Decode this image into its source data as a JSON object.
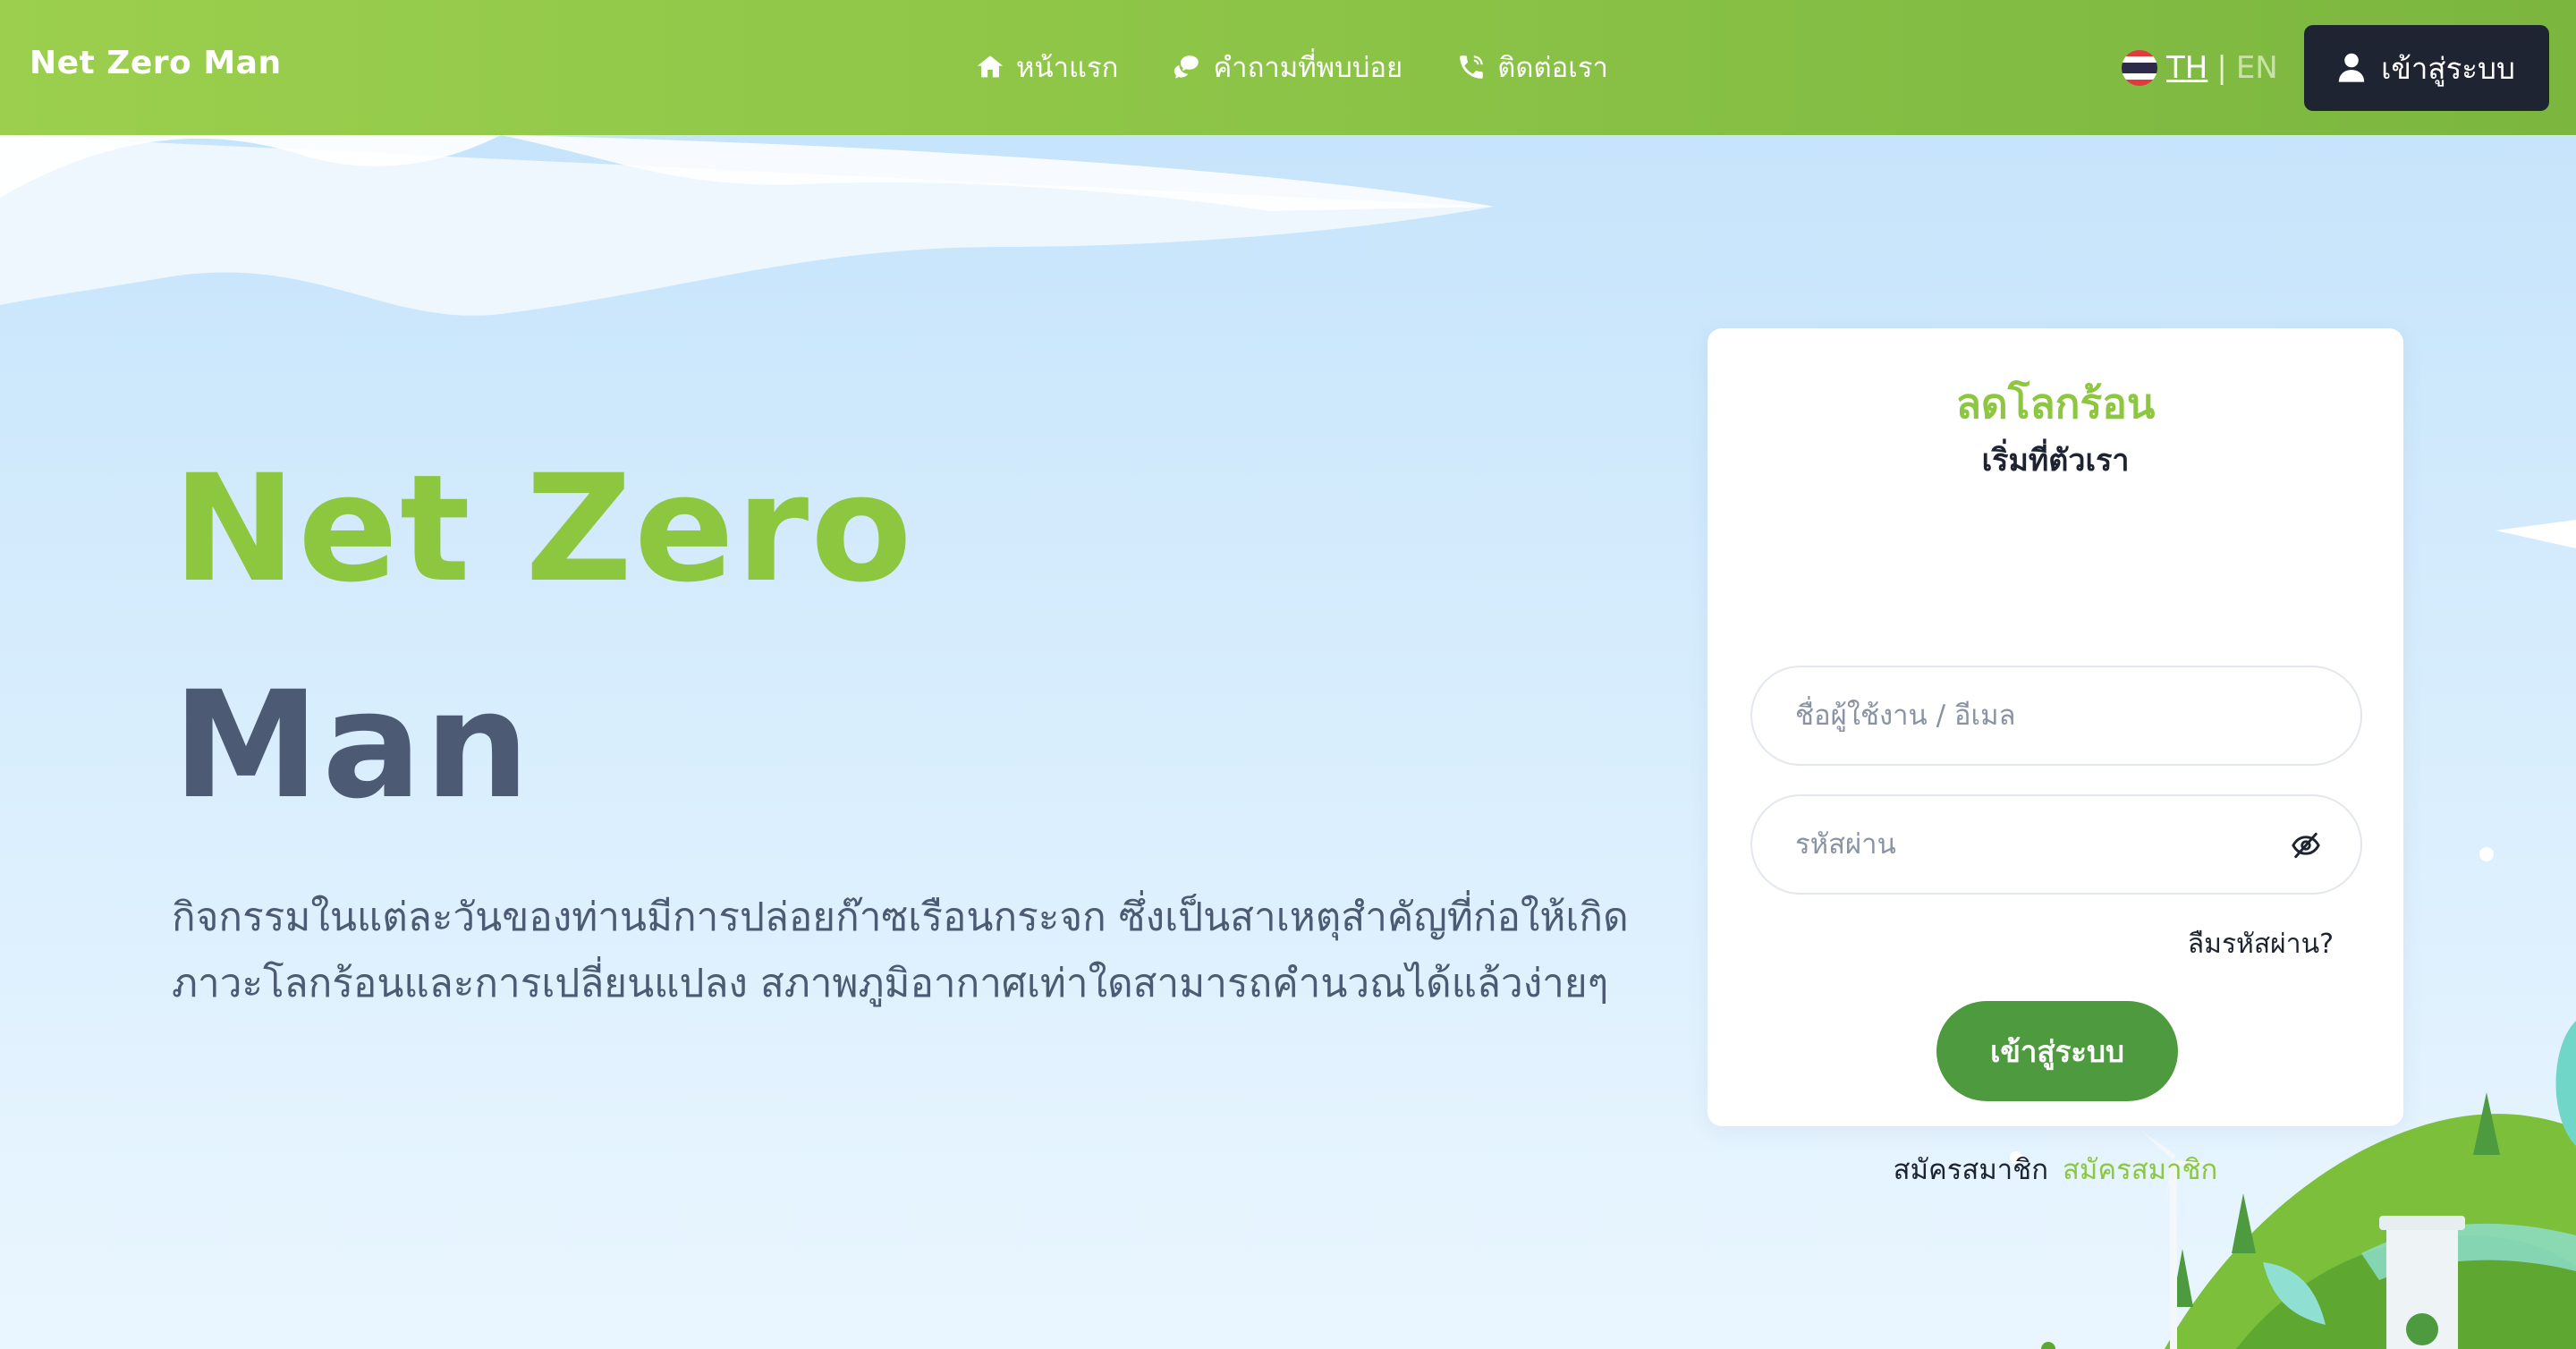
{
  "navbar": {
    "brand": "Net Zero Man",
    "links": [
      {
        "label": "หน้าแรก",
        "icon": "home-icon"
      },
      {
        "label": "คำถามที่พบบ่อย",
        "icon": "chat-bubbles-icon"
      },
      {
        "label": "ติดต่อเรา",
        "icon": "phone-icon"
      }
    ],
    "lang": {
      "th": "TH",
      "sep": "|",
      "en": "EN",
      "flag": "thailand-flag-icon"
    },
    "login_label": "เข้าสู่ระบบ"
  },
  "hero": {
    "title_line1": "Net Zero",
    "title_line2": "Man",
    "description": "กิจกรรมในแต่ละวันของท่านมีการปล่อยก๊าซเรือนกระจก ซึ่งเป็นสาเหตุสำคัญที่ก่อให้เกิดภาวะโลกร้อนและการเปลี่ยนแปลง สภาพภูมิอากาศเท่าใดสามารถคำนวณได้แล้วง่ายๆ"
  },
  "login_card": {
    "title": "ลดโลกร้อน",
    "subtitle": "เริ่มที่ตัวเรา",
    "username_placeholder": "ชื่อผู้ใช้งาน / อีเมล",
    "password_placeholder": "รหัสผ่าน",
    "forgot_label": "ลืมรหัสผ่าน?",
    "submit_label": "เข้าสู่ระบบ",
    "register_text": "สมัครสมาชิก",
    "register_link": "สมัครสมาชิก"
  },
  "colors": {
    "navbar": "#8cc447",
    "accent_green": "#8dc63f",
    "button_green": "#4e9a3f",
    "dark_button": "#1f2433",
    "title_dark": "#4d5a74"
  }
}
